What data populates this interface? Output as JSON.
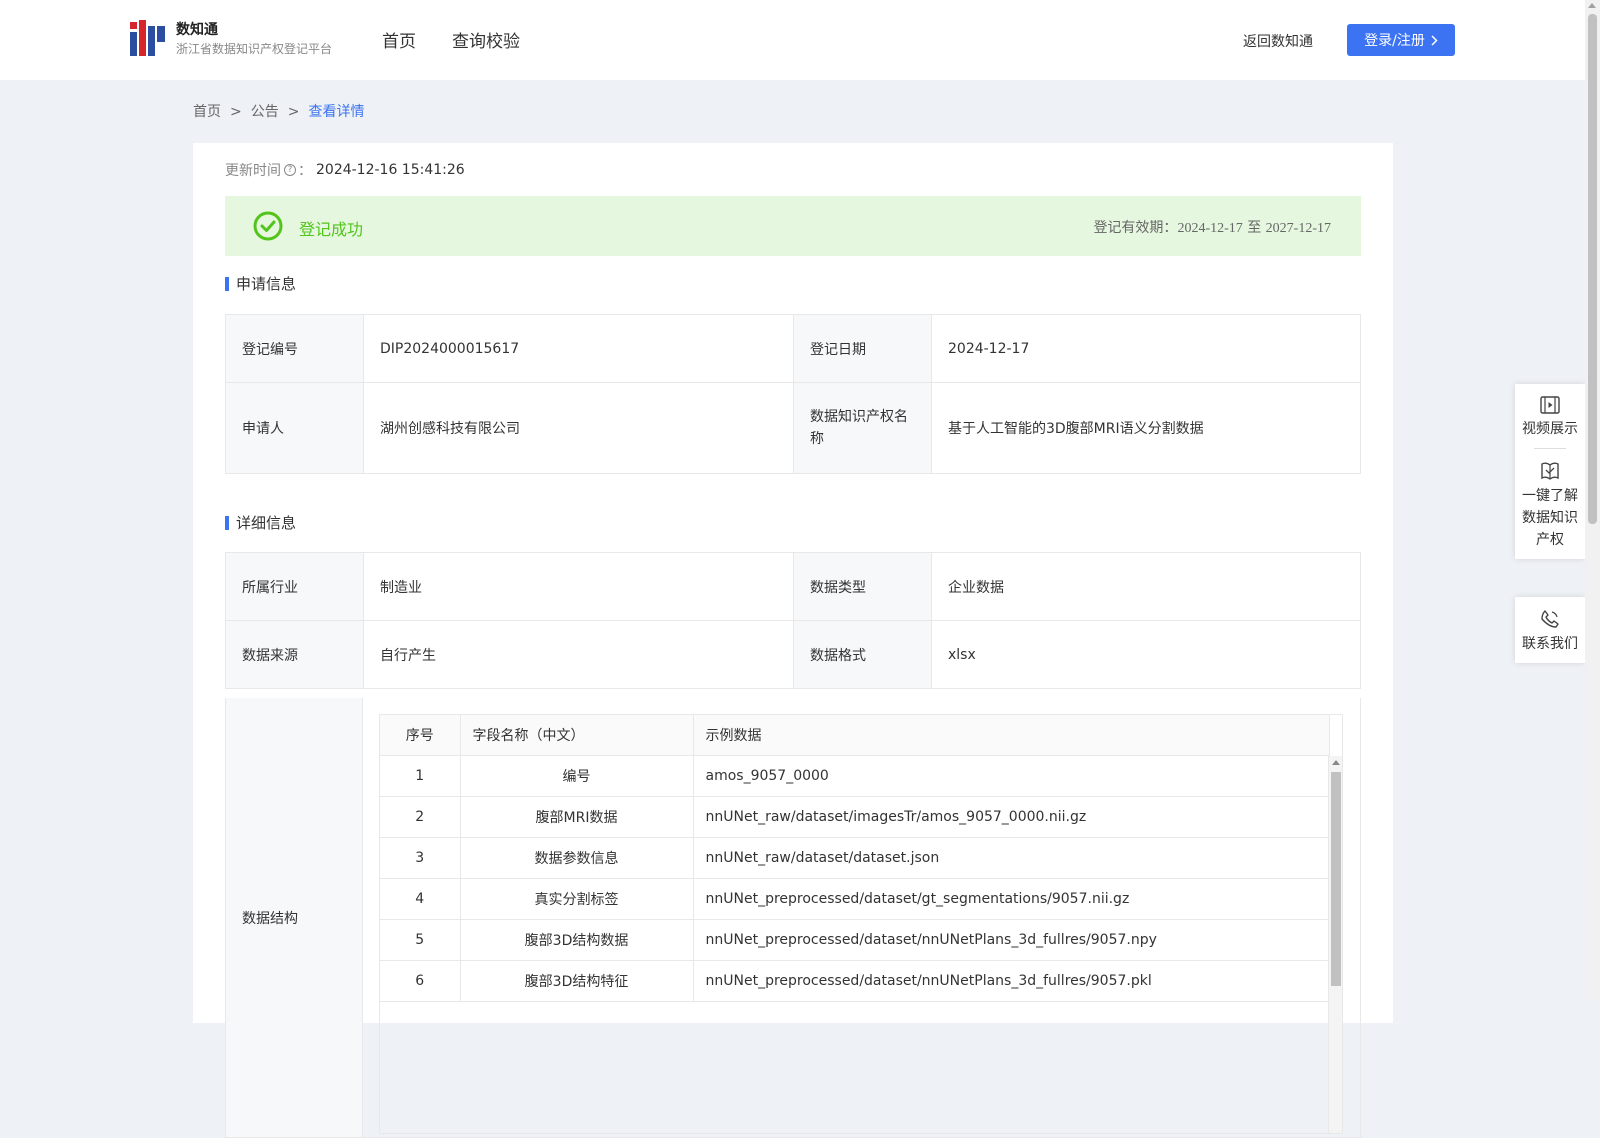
{
  "header": {
    "logo_title": "数知通",
    "logo_subtitle": "浙江省数据知识产权登记平台",
    "nav": [
      "首页",
      "查询校验"
    ],
    "back_link": "返回数知通",
    "login_label": "登录/注册"
  },
  "breadcrumb": {
    "items": [
      "首页",
      "公告"
    ],
    "current": "查看详情",
    "separator": ">"
  },
  "update": {
    "label": "更新时间",
    "colon": "：",
    "value": "2024-12-16 15:41:26"
  },
  "status": {
    "text": "登记成功",
    "validity_label": "登记有效期：",
    "start": "2024-12-17",
    "to": "至",
    "end": "2027-12-17",
    "color": "#52c41a"
  },
  "application": {
    "title": "申请信息",
    "rows": [
      {
        "l1": "登记编号",
        "v1": "DIP2024000015617",
        "l2": "登记日期",
        "v2": "2024-12-17"
      },
      {
        "l1": "申请人",
        "v1": "湖州创感科技有限公司",
        "l2": "数据知识产权名称",
        "v2": "基于人工智能的3D腹部MRI语义分割数据"
      }
    ]
  },
  "details": {
    "title": "详细信息",
    "rows": [
      {
        "l1": "所属行业",
        "v1": "制造业",
        "l2": "数据类型",
        "v2": "企业数据"
      },
      {
        "l1": "数据来源",
        "v1": "自行产生",
        "l2": "数据格式",
        "v2": "xlsx"
      }
    ],
    "structure_label": "数据结构",
    "structure_headers": [
      "序号",
      "字段名称（中文）",
      "示例数据"
    ],
    "structure_rows": [
      {
        "no": "1",
        "name": "编号",
        "example": "amos_9057_0000"
      },
      {
        "no": "2",
        "name": "腹部MRI数据",
        "example": "nnUNet_raw/dataset/imagesTr/amos_9057_0000.nii.gz"
      },
      {
        "no": "3",
        "name": "数据参数信息",
        "example": "nnUNet_raw/dataset/dataset.json"
      },
      {
        "no": "4",
        "name": "真实分割标签",
        "example": "nnUNet_preprocessed/dataset/gt_segmentations/9057.nii.gz"
      },
      {
        "no": "5",
        "name": "腹部3D结构数据",
        "example": "nnUNet_preprocessed/dataset/nnUNetPlans_3d_fullres/9057.npy"
      },
      {
        "no": "6",
        "name": "腹部3D结构特征",
        "example": "nnUNet_preprocessed/dataset/nnUNetPlans_3d_fullres/9057.pkl"
      }
    ]
  },
  "float_tools": {
    "video": "视频展示",
    "learn": [
      "一键了解",
      "数据知识",
      "产权"
    ],
    "contact": "联系我们"
  },
  "colors": {
    "accent": "#3b73f3",
    "success": "#52c41a",
    "success_bg": "#e6f7e0"
  }
}
